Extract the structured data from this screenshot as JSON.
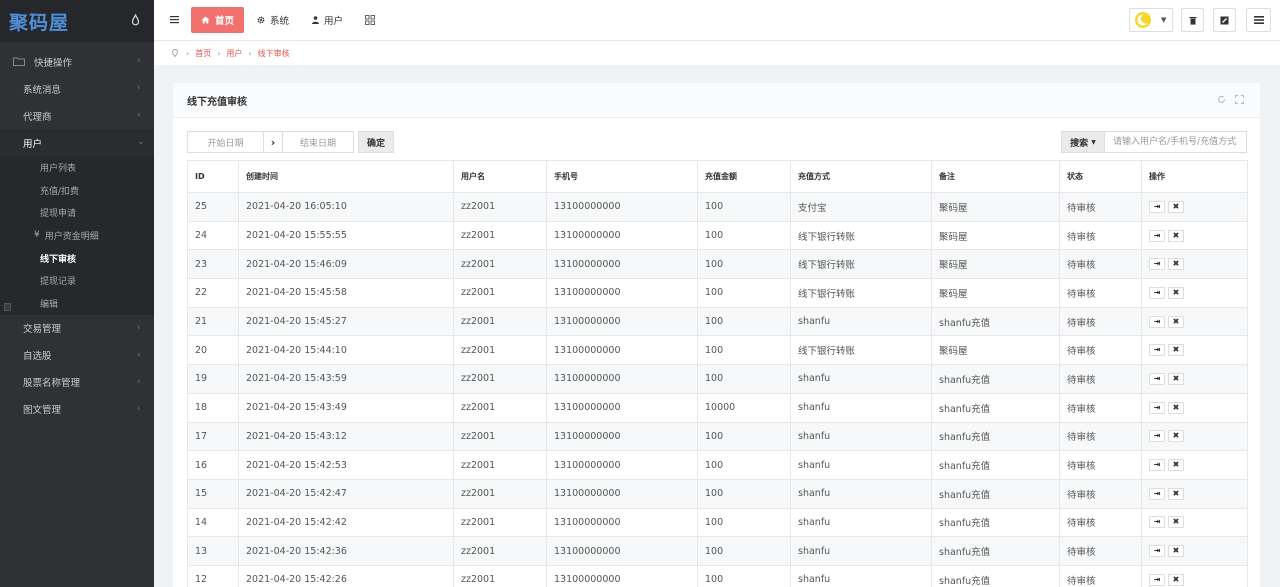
{
  "sidebar": {
    "logo": "聚码屋",
    "groups": [
      {
        "label": "快捷操作"
      },
      {
        "label": "系统消息"
      },
      {
        "label": "代理商"
      },
      {
        "label": "用户"
      },
      {
        "label": "交易管理"
      },
      {
        "label": "自选股"
      },
      {
        "label": "股票名称管理"
      },
      {
        "label": "图文管理"
      }
    ],
    "sub_items": [
      {
        "label": "用户列表"
      },
      {
        "label": "充值/扣费"
      },
      {
        "label": "提现申请"
      },
      {
        "label": "用户资金明细",
        "prefix": "¥"
      },
      {
        "label": "线下审核"
      },
      {
        "label": "提现记录"
      },
      {
        "label": "编辑"
      }
    ]
  },
  "topbar": {
    "home": "首页",
    "system": "系统",
    "user": "用户"
  },
  "breadcrumb": [
    "首页",
    "用户",
    "线下审核"
  ],
  "card": {
    "title": "线下充值审核",
    "start_date_placeholder": "开始日期",
    "end_date_placeholder": "结束日期",
    "confirm": "确定",
    "search": "搜索",
    "search_placeholder": "请输入用户名/手机号/充值方式"
  },
  "table": {
    "headers": [
      "ID",
      "创建时间",
      "用户名",
      "手机号",
      "充值金额",
      "充值方式",
      "备注",
      "状态",
      "操作"
    ],
    "rows": [
      [
        "25",
        "2021-04-20 16:05:10",
        "zz2001",
        "13100000000",
        "100",
        "支付宝",
        "聚码屋",
        "待审核"
      ],
      [
        "24",
        "2021-04-20 15:55:55",
        "zz2001",
        "13100000000",
        "100",
        "线下银行转账",
        "聚码屋",
        "待审核"
      ],
      [
        "23",
        "2021-04-20 15:46:09",
        "zz2001",
        "13100000000",
        "100",
        "线下银行转账",
        "聚码屋",
        "待审核"
      ],
      [
        "22",
        "2021-04-20 15:45:58",
        "zz2001",
        "13100000000",
        "100",
        "线下银行转账",
        "聚码屋",
        "待审核"
      ],
      [
        "21",
        "2021-04-20 15:45:27",
        "zz2001",
        "13100000000",
        "100",
        "shanfu",
        "shanfu充值",
        "待审核"
      ],
      [
        "20",
        "2021-04-20 15:44:10",
        "zz2001",
        "13100000000",
        "100",
        "线下银行转账",
        "聚码屋",
        "待审核"
      ],
      [
        "19",
        "2021-04-20 15:43:59",
        "zz2001",
        "13100000000",
        "100",
        "shanfu",
        "shanfu充值",
        "待审核"
      ],
      [
        "18",
        "2021-04-20 15:43:49",
        "zz2001",
        "13100000000",
        "10000",
        "shanfu",
        "shanfu充值",
        "待审核"
      ],
      [
        "17",
        "2021-04-20 15:43:12",
        "zz2001",
        "13100000000",
        "100",
        "shanfu",
        "shanfu充值",
        "待审核"
      ],
      [
        "16",
        "2021-04-20 15:42:53",
        "zz2001",
        "13100000000",
        "100",
        "shanfu",
        "shanfu充值",
        "待审核"
      ],
      [
        "15",
        "2021-04-20 15:42:47",
        "zz2001",
        "13100000000",
        "100",
        "shanfu",
        "shanfu充值",
        "待审核"
      ],
      [
        "14",
        "2021-04-20 15:42:42",
        "zz2001",
        "13100000000",
        "100",
        "shanfu",
        "shanfu充值",
        "待审核"
      ],
      [
        "13",
        "2021-04-20 15:42:36",
        "zz2001",
        "13100000000",
        "100",
        "shanfu",
        "shanfu充值",
        "待审核"
      ],
      [
        "12",
        "2021-04-20 15:42:26",
        "zz2001",
        "13100000000",
        "100",
        "shanfu",
        "shanfu充值",
        "待审核"
      ]
    ],
    "op_approve": "⇥",
    "op_reject": "✖"
  },
  "colors": {
    "accent": "#f0716e",
    "sidebar_bg": "#2f3135",
    "logo": "#4f8fd9"
  },
  "icons": {
    "sidebar_toggle": "water-drop-icon",
    "menu": "hamburger-icon",
    "home": "home-icon",
    "system": "gear-icon",
    "user": "user-icon",
    "apps": "grid-icon",
    "theme": "moon-icon",
    "trash": "trash-icon",
    "edit": "edit-icon",
    "settings": "list-icon",
    "refresh": "refresh-icon",
    "fullscreen": "expand-icon"
  }
}
